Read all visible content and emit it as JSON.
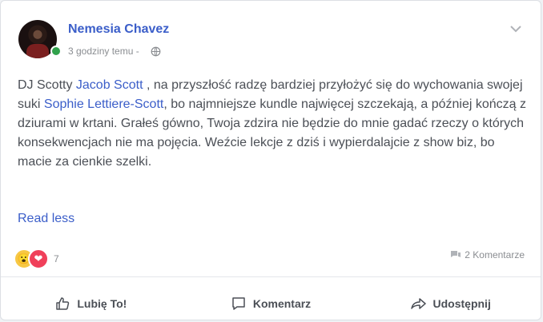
{
  "post": {
    "author": "Nemesia Chavez",
    "time": "3 godziny temu -",
    "body_parts": {
      "p1": "DJ Scotty ",
      "m1": "Jacob Scott",
      "p2": " , na przyszłość radzę bardziej przyłożyć się do wychowania swojej suki ",
      "m2": "Sophie Lettiere-Scott",
      "p3": ", bo najmniejsze kundle najwięcej szczekają, a później kończą z dziurami w krtani. Grałeś gówno, Twoja zdzira nie będzie do mnie gadać rzeczy o których konsekwencjach nie ma pojęcia. Weźcie lekcje z dziś i wypierdalajcie z show biz, bo macie za cienkie szelki."
    },
    "read_less": "Read less",
    "reactions_count": "7",
    "comments_count": "2 Komentarze"
  },
  "actions": {
    "like": "Lubię To!",
    "comment": "Komentarz",
    "share": "Udostępnij"
  },
  "colors": {
    "link": "#3b5ec9",
    "online": "#31a24c"
  },
  "icons": [
    "globe-icon",
    "chevron-down-icon",
    "comment-icon",
    "like-icon",
    "share-icon",
    "wow-reaction",
    "love-reaction"
  ]
}
